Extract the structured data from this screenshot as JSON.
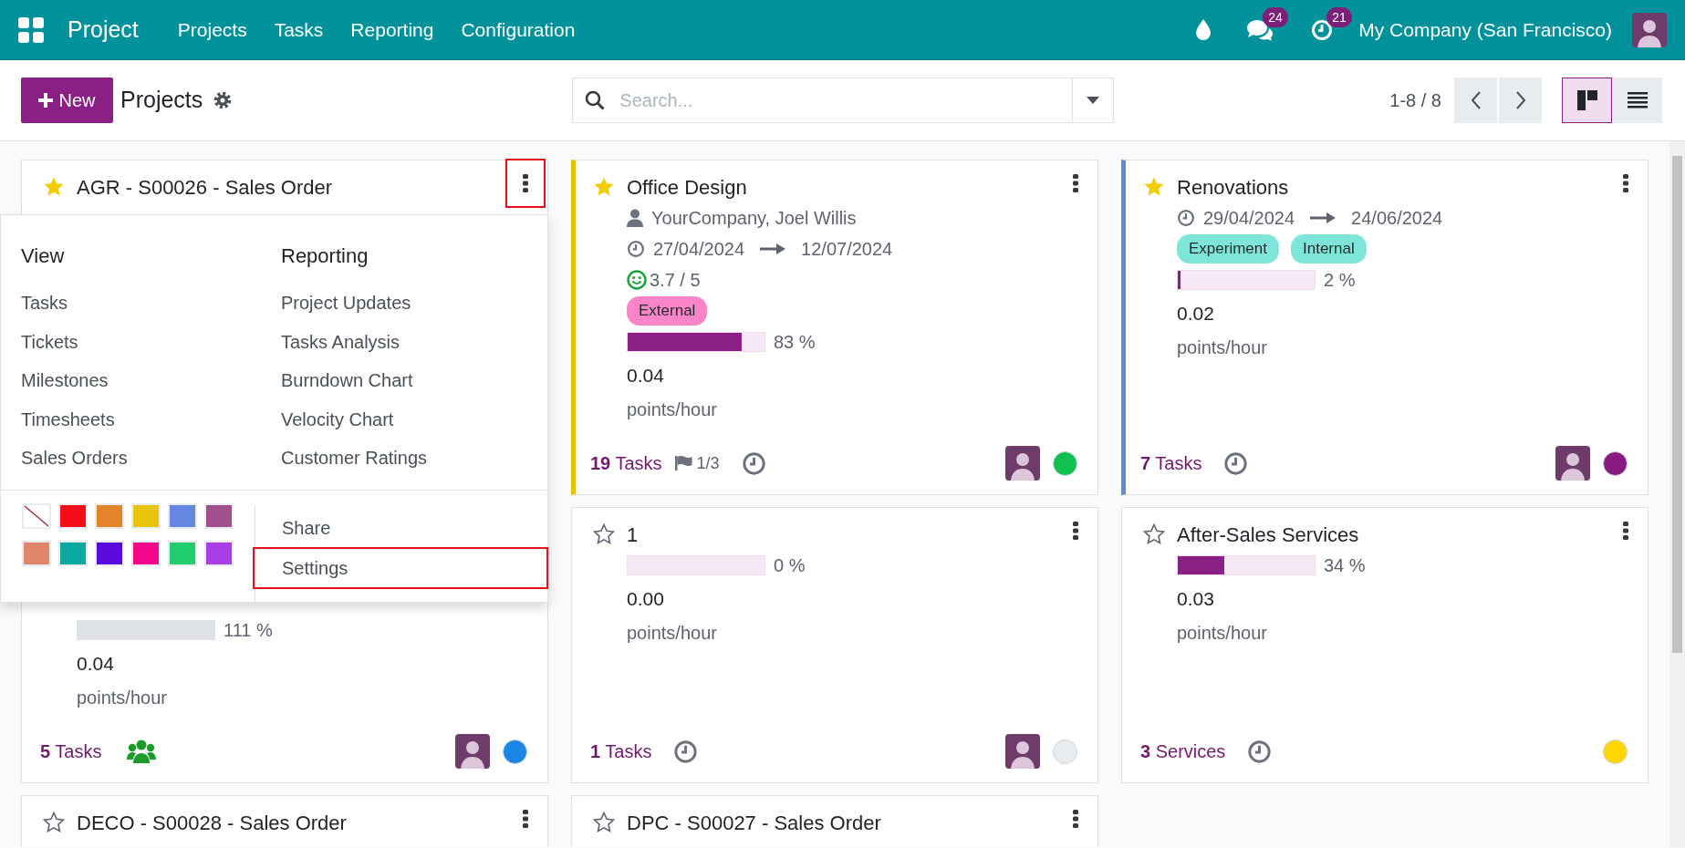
{
  "navbar": {
    "brand": "Project",
    "menu": [
      {
        "label": "Projects"
      },
      {
        "label": "Tasks"
      },
      {
        "label": "Reporting"
      },
      {
        "label": "Configuration"
      }
    ],
    "messages_badge": "24",
    "activities_badge": "21",
    "company": "My Company (San Francisco)"
  },
  "control_panel": {
    "new_button": "New",
    "title": "Projects",
    "search": {
      "placeholder": "Search..."
    },
    "pager": "1-8 / 8",
    "views": [
      {
        "kind": "kanban",
        "selected": true
      },
      {
        "kind": "list",
        "selected": false
      }
    ]
  },
  "columns": [
    {
      "cards": [
        {
          "title": "AGR - S00026 - Sales Order",
          "favorite": true,
          "highlighted": true,
          "menu_open": true,
          "menu": {
            "sections": [
              {
                "heading": "View",
                "items": [
                  "Tasks",
                  "Tickets",
                  "Milestones",
                  "Timesheets",
                  "Sales Orders"
                ]
              },
              {
                "heading": "Reporting",
                "items": [
                  "Project Updates",
                  "Tasks Analysis",
                  "Burndown Chart",
                  "Velocity Chart",
                  "Customer Ratings"
                ]
              }
            ],
            "colors": [
              {
                "kind": "none"
              },
              {
                "kind": "swatch",
                "color": "#f70d1a"
              },
              {
                "kind": "swatch",
                "color": "#e4842a"
              },
              {
                "kind": "swatch",
                "color": "#e8c40a"
              },
              {
                "kind": "swatch",
                "color": "#6587e1"
              },
              {
                "kind": "swatch",
                "color": "#a24f8e"
              },
              {
                "kind": "swatch",
                "color": "#e2866b"
              },
              {
                "kind": "swatch",
                "color": "#0aa9a0"
              },
              {
                "kind": "swatch",
                "color": "#5a0adf"
              },
              {
                "kind": "swatch",
                "color": "#f5068a"
              },
              {
                "kind": "swatch",
                "color": "#21cd6c"
              },
              {
                "kind": "swatch",
                "color": "#a93de8"
              }
            ],
            "actions": [
              {
                "label": "Share",
                "highlighted": false
              },
              {
                "label": "Settings",
                "highlighted": true
              }
            ]
          },
          "progress": {
            "level": 1,
            "over": true,
            "reading": "111 %"
          },
          "velocity": "0.04",
          "unit": "points/hour",
          "footer": {
            "count": "**5** Tasks",
            "indicators": [
              {
                "kind": "team"
              }
            ],
            "avatar": true,
            "color": "#1a87e6"
          }
        },
        {
          "title": "DECO - S00028 - Sales Order",
          "favorite": false,
          "highlighted": false
        }
      ]
    },
    {
      "cards": [
        {
          "title": "Office Design",
          "favorite": true,
          "highlighted": false,
          "color": "#e6c300",
          "partner": "YourCompany, Joel Willis",
          "dates": [
            "27/04/2024",
            "12/07/2024"
          ],
          "rating": "3.7 / 5",
          "tags": [
            {
              "label": "External",
              "color": "#fb85c8"
            }
          ],
          "progress": {
            "level": 0.83,
            "over": false,
            "reading": "83 %"
          },
          "velocity": "0.04",
          "unit": "points/hour",
          "footer": {
            "count": "**19** Tasks",
            "indicators": [
              {
                "kind": "milestone",
                "text": "1/3"
              },
              {
                "kind": "activity"
              }
            ],
            "avatar": true,
            "color": "#10c050"
          }
        },
        {
          "title": "1",
          "favorite": false,
          "highlighted": false,
          "progress": {
            "level": 0,
            "over": false,
            "reading": "0 %"
          },
          "velocity": "0.00",
          "unit": "points/hour",
          "footer": {
            "count": "**1** Tasks",
            "indicators": [
              {
                "kind": "activity"
              }
            ],
            "avatar": true,
            "color": "#e9ecef"
          }
        },
        {
          "title": "DPC - S00027 - Sales Order",
          "favorite": false,
          "highlighted": false
        }
      ]
    },
    {
      "cards": [
        {
          "title": "Renovations",
          "favorite": true,
          "highlighted": false,
          "color": "#6587e1",
          "dates": [
            "29/04/2024",
            "24/06/2024"
          ],
          "tags": [
            {
              "label": "Experiment",
              "color": "#7ee6d9"
            },
            {
              "label": "Internal",
              "color": "#7ee6d9"
            }
          ],
          "progress": {
            "level": 0.02,
            "over": false,
            "reading": "2 %"
          },
          "velocity": "0.02",
          "unit": "points/hour",
          "footer": {
            "count": "**7** Tasks",
            "indicators": [
              {
                "kind": "activity"
              }
            ],
            "avatar": true,
            "color": "#8a1a82"
          }
        },
        {
          "title": "After-Sales Services",
          "favorite": false,
          "highlighted": false,
          "progress": {
            "level": 0.34,
            "over": false,
            "reading": "34 %"
          },
          "velocity": "0.03",
          "unit": "points/hour",
          "footer": {
            "count": "**3** Services",
            "indicators": [
              {
                "kind": "activity"
              }
            ],
            "avatar": false,
            "color": "#ffd600"
          }
        }
      ]
    }
  ]
}
